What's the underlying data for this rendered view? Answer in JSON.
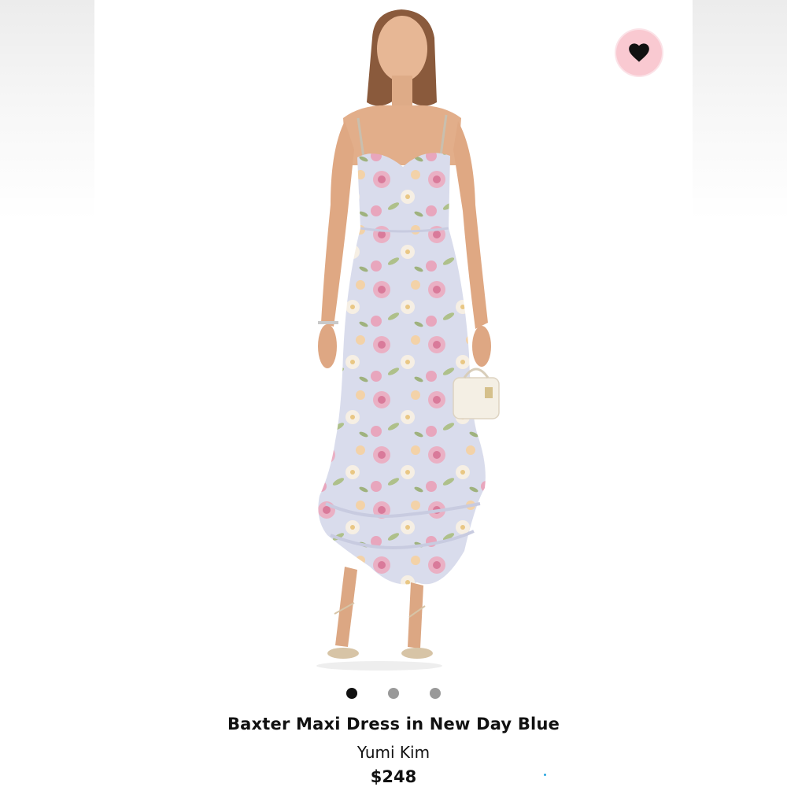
{
  "product": {
    "name": "Baxter Maxi Dress in New Day Blue",
    "brand": "Yumi Kim",
    "price": "$248"
  },
  "gallery": {
    "image_count": 3,
    "active_index": 0
  },
  "favorite": {
    "icon": "heart-icon",
    "active": true
  },
  "colors": {
    "favorite_bg": "#f9c9d1",
    "active_dot": "#111111",
    "inactive_dot": "#999999"
  }
}
